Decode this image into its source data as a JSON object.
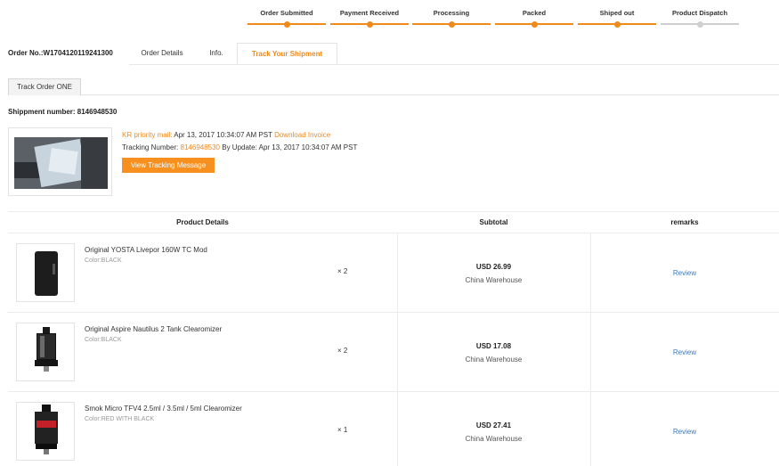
{
  "progress": {
    "steps": [
      {
        "label": "Order Submitted",
        "done": true
      },
      {
        "label": "Payment Received",
        "done": true
      },
      {
        "label": "Processing",
        "done": true
      },
      {
        "label": "Packed",
        "done": true
      },
      {
        "label": "Shiped out",
        "done": true
      },
      {
        "label": "Product Dispatch",
        "done": false
      }
    ],
    "active_color": "#f08a1c",
    "pending_color": "#cfcfcf"
  },
  "order": {
    "number_label": "Order No.:W1704120119241300"
  },
  "tabs": [
    {
      "label": "Order Details",
      "active": false
    },
    {
      "label": "Info.",
      "active": false
    },
    {
      "label": "Track Your Shipment",
      "active": true
    }
  ],
  "subtab": {
    "label": "Track Order ONE"
  },
  "shipment": {
    "number_label": "Shippment number: 8146948530",
    "carrier": "KR priority mail:",
    "date": "Apr 13, 2017 10:34:07 AM PST",
    "invoice_link": "Download Invoice",
    "tracking_label": "Tracking Number:",
    "tracking_number": "8146948530",
    "update_label": "By Update:",
    "update_date": "Apr 13, 2017 10:34:07 AM PST",
    "button_label": "View Tracking Message",
    "photo_icon": "package-photo"
  },
  "table": {
    "headers": {
      "details": "Product Details",
      "subtotal": "Subtotal",
      "remarks": "remarks"
    },
    "rows": [
      {
        "name": "Original YOSTA Livepor 160W TC Mod",
        "color": "Color:BLACK",
        "qty": "× 2",
        "price": "USD 26.99",
        "warehouse": "China Warehouse",
        "review": "Review",
        "icon": "box-mod-icon"
      },
      {
        "name": "Original Aspire Nautilus 2 Tank Clearomizer",
        "color": "Color:BLACK",
        "qty": "× 2",
        "price": "USD 17.08",
        "warehouse": "China Warehouse",
        "review": "Review",
        "icon": "tank-icon"
      },
      {
        "name": "Smok Micro TFV4 2.5ml / 3.5ml / 5ml Clearomizer",
        "color": "Color:RED WITH BLACK",
        "qty": "× 1",
        "price": "USD 27.41",
        "warehouse": "China Warehouse",
        "review": "Review",
        "icon": "tank-icon"
      }
    ]
  },
  "colors": {
    "accent": "#f08a1c",
    "button": "#f7901e",
    "link_blue": "#3b7bbf"
  }
}
